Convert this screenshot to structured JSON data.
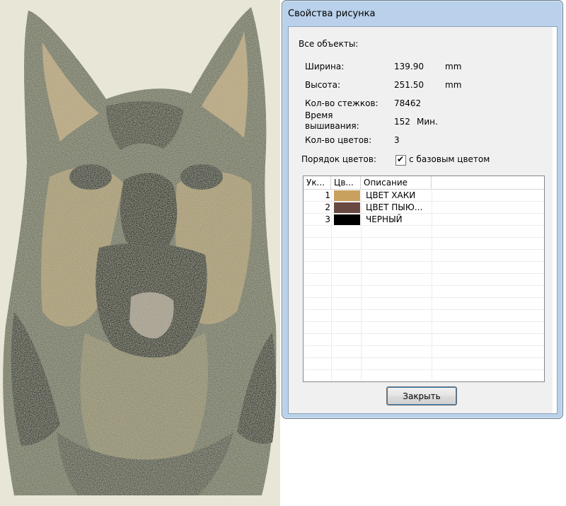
{
  "preview": {
    "icon": "embroidered-dog-image"
  },
  "dialog": {
    "title": "Свойства рисунка",
    "all_objects_label": "Все объекты:",
    "width_label": "Ширина:",
    "width_value": "139.90",
    "width_unit": "mm",
    "height_label": "Высота:",
    "height_value": "251.50",
    "height_unit": "mm",
    "stitches_label": "Кол-во стежков:",
    "stitches_value": "78462",
    "time_label_1": "Время",
    "time_label_2": "вышивания:",
    "time_value": "152",
    "time_unit": "Мин.",
    "colors_label": "Кол-во цветов:",
    "colors_value": "3",
    "order_label": "Порядок цветов:",
    "base_color_checkbox": "с базовым цветом",
    "base_color_checked": true,
    "close_button": "Закрыть"
  },
  "color_list": {
    "columns": [
      "Ук...",
      "Цв...",
      "Описание"
    ],
    "rows": [
      {
        "num": "1",
        "color": "#c9a15f",
        "description": "ЦВЕТ ХАКИ"
      },
      {
        "num": "2",
        "color": "#684a42",
        "description": "ЦВЕТ ПЫЮ..."
      },
      {
        "num": "3",
        "color": "#000000",
        "description": "ЧЕРНЫЙ"
      }
    ]
  }
}
